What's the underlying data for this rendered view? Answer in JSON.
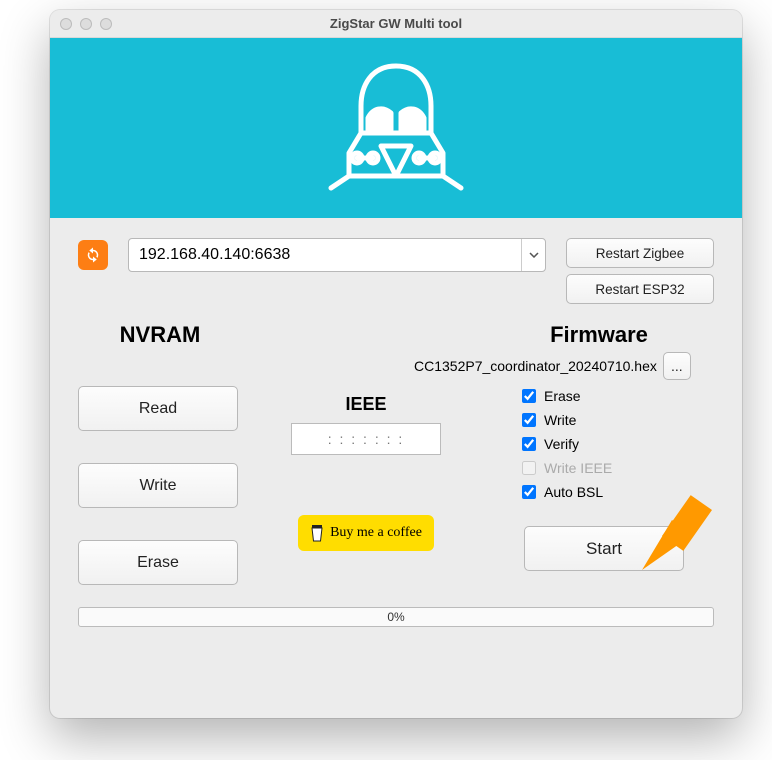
{
  "window": {
    "title": "ZigStar GW Multi tool"
  },
  "connection": {
    "address": "192.168.40.140:6638"
  },
  "side_buttons": {
    "restart_zigbee": "Restart Zigbee",
    "restart_esp32": "Restart ESP32"
  },
  "nvram": {
    "heading": "NVRAM",
    "read": "Read",
    "write": "Write",
    "erase": "Erase"
  },
  "ieee": {
    "heading": "IEEE",
    "placeholder": ": : : : : : :"
  },
  "coffee": {
    "label": "Buy me a coffee"
  },
  "firmware": {
    "heading": "Firmware",
    "file": "CC1352P7_coordinator_20240710.hex",
    "browse": "...",
    "erase_label": "Erase",
    "write_label": "Write",
    "verify_label": "Verify",
    "write_ieee_label": "Write IEEE",
    "auto_bsl_label": "Auto BSL",
    "erase_checked": true,
    "write_checked": true,
    "verify_checked": true,
    "write_ieee_checked": false,
    "write_ieee_disabled": true,
    "auto_bsl_checked": true,
    "start": "Start"
  },
  "progress": {
    "text": "0%"
  },
  "colors": {
    "banner": "#18bdd6",
    "refresh": "#fd7e14",
    "coffee": "#ffdd00",
    "arrow": "#ff9900"
  }
}
